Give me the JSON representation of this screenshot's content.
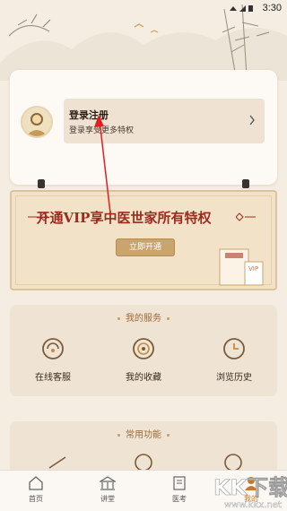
{
  "status": {
    "time": "3:30"
  },
  "login": {
    "title": "登录注册",
    "subtitle": "登录享受更多特权"
  },
  "vip": {
    "title": "开通VIP享中医世家所有特权",
    "button": "立即开通",
    "card_badge": "VIP"
  },
  "services": {
    "title": "我的服务",
    "items": [
      {
        "label": "在线客服",
        "icon": "headset-icon"
      },
      {
        "label": "我的收藏",
        "icon": "favorite-icon"
      },
      {
        "label": "浏览历史",
        "icon": "history-clock-icon"
      }
    ]
  },
  "common": {
    "title": "常用功能"
  },
  "tabs": [
    {
      "label": "首页",
      "icon": "home-icon"
    },
    {
      "label": "讲堂",
      "icon": "lecture-hall-icon"
    },
    {
      "label": "医考",
      "icon": "exam-icon"
    },
    {
      "label": "我的",
      "icon": "profile-icon",
      "active": true
    }
  ],
  "watermark": {
    "text": "KK下载",
    "url": "www.kkx.net"
  },
  "colors": {
    "accent": "#c47a2c",
    "vip_red": "#9e2a1f",
    "gold": "#c9a46c",
    "background": "#f5ede1"
  }
}
